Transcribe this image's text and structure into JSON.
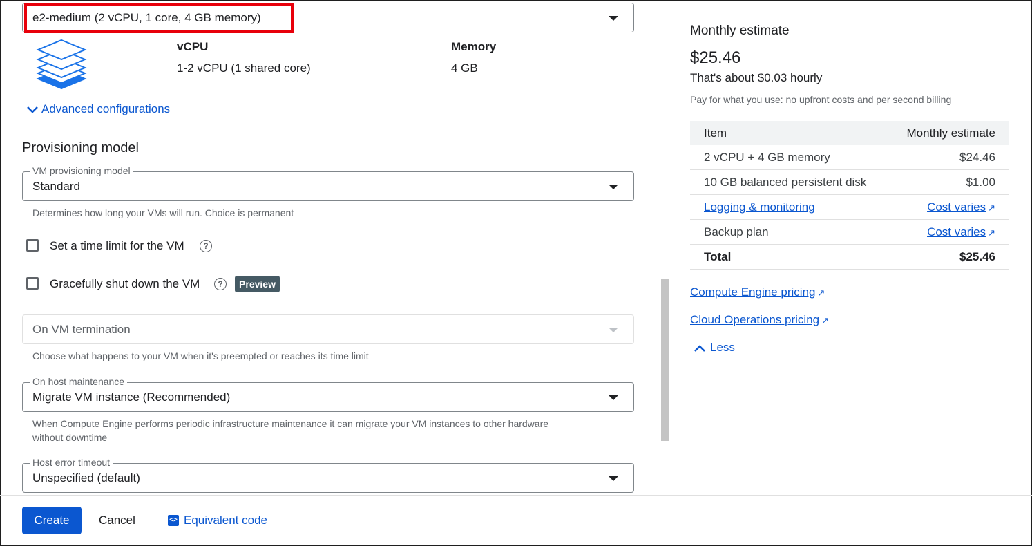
{
  "machine": {
    "selected": "e2-medium (2 vCPU, 1 core, 4 GB memory)",
    "vcpu_header": "vCPU",
    "vcpu_value": "1-2 vCPU (1 shared core)",
    "memory_header": "Memory",
    "memory_value": "4 GB",
    "advanced": "Advanced configurations"
  },
  "provisioning": {
    "title": "Provisioning model",
    "model_label": "VM provisioning model",
    "model_value": "Standard",
    "model_hint": "Determines how long your VMs will run. Choice is permanent",
    "time_limit_label": "Set a time limit for the VM",
    "shutdown_label": "Gracefully shut down the VM",
    "preview_badge": "Preview",
    "termination_value": "On VM termination",
    "termination_hint": "Choose what happens to your VM when it's preempted or reaches its time limit",
    "host_maint_label": "On host maintenance",
    "host_maint_value": "Migrate VM instance (Recommended)",
    "host_maint_hint1": "When Compute Engine performs periodic infrastructure maintenance it can migrate your VM instances to other hardware",
    "host_maint_hint2": "without downtime",
    "host_error_label": "Host error timeout",
    "host_error_value": "Unspecified (default)"
  },
  "estimate": {
    "title": "Monthly estimate",
    "price": "$25.46",
    "hourly": "That's about $0.03 hourly",
    "note": "Pay for what you use: no upfront costs and per second billing",
    "col_item": "Item",
    "col_estimate": "Monthly estimate",
    "rows": [
      {
        "item": "2 vCPU + 4 GB memory",
        "value": "$24.46"
      },
      {
        "item": "10 GB balanced persistent disk",
        "value": "$1.00"
      },
      {
        "item": "Logging & monitoring",
        "value": "Cost varies"
      },
      {
        "item": "Backup plan",
        "value": "Cost varies"
      },
      {
        "item": "Total",
        "value": "$25.46"
      }
    ],
    "compute_pricing": "Compute Engine pricing",
    "ops_pricing": "Cloud Operations pricing",
    "less": "Less"
  },
  "footer": {
    "create": "Create",
    "cancel": "Cancel",
    "equivalent_code": "Equivalent code"
  },
  "colors": {
    "accent": "#0b57d0",
    "highlight": "#e8000b"
  }
}
